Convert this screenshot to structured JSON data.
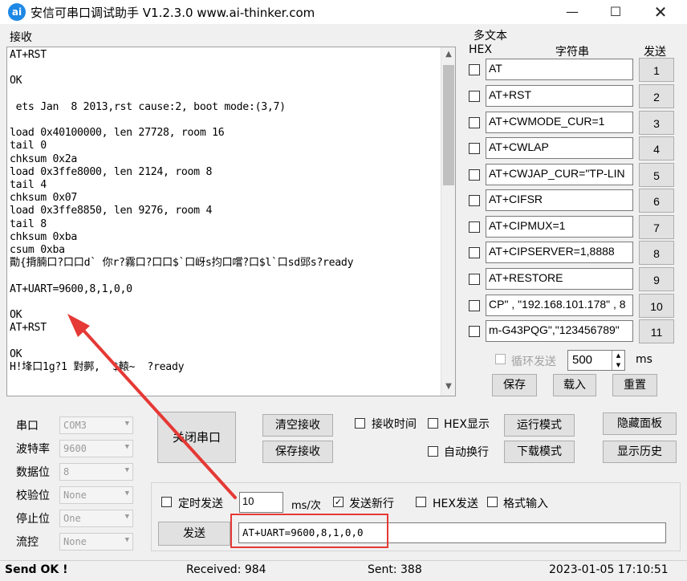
{
  "window": {
    "title": "安信可串口调试助手 V1.2.3.0    www.ai-thinker.com",
    "icon_text": "ai",
    "min_glyph": "—",
    "max_glyph": "☐",
    "close_glyph": "✕"
  },
  "receive": {
    "label": "接收",
    "text": "AT+RST\n\nOK\n\n ets Jan  8 2013,rst cause:2, boot mode:(3,7)\n\nload 0x40100000, len 27728, room 16\ntail 0\nchksum 0x2a\nload 0x3ffe8000, len 2124, room 8\ntail 4\nchksum 0x07\nload 0x3ffe8850, len 9276, room 4\ntail 8\nchksum 0xba\ncsum 0xba\n勩{揹腩口?口口d` 你r?霧口?口口$`口岈s抣口嚐?口$l`口sd郖s?ready\n\nAT+UART=9600,8,1,0,0\n\nOK\nAT+RST\n\nOK\nH!埄口1g?1 對鄸,  $轅~  ?ready"
  },
  "multi_text": {
    "label": "多文本",
    "hex_header": "HEX",
    "string_header": "字符串",
    "send_header": "发送",
    "rows": [
      {
        "value": "AT",
        "btn": "1"
      },
      {
        "value": "AT+RST",
        "btn": "2"
      },
      {
        "value": "AT+CWMODE_CUR=1",
        "btn": "3"
      },
      {
        "value": "AT+CWLAP",
        "btn": "4"
      },
      {
        "value": "AT+CWJAP_CUR=\"TP-LIN",
        "btn": "5"
      },
      {
        "value": "AT+CIFSR",
        "btn": "6"
      },
      {
        "value": "AT+CIPMUX=1",
        "btn": "7"
      },
      {
        "value": "AT+CIPSERVER=1,8888",
        "btn": "8"
      },
      {
        "value": "AT+RESTORE",
        "btn": "9"
      },
      {
        "value": "CP\" , \"192.168.101.178\" , 8",
        "btn": "10"
      },
      {
        "value": "m-G43PQG\",\"123456789\"",
        "btn": "11"
      }
    ],
    "loop_label": "循环发送",
    "loop_ms": "500",
    "ms_label": "ms",
    "save": "保存",
    "load": "载入",
    "reset": "重置"
  },
  "serial": {
    "port_label": "串口",
    "port_value": "COM3",
    "baud_label": "波特率",
    "baud_value": "9600",
    "data_label": "数据位",
    "data_value": "8",
    "parity_label": "校验位",
    "parity_value": "None",
    "stop_label": "停止位",
    "stop_value": "One",
    "flow_label": "流控",
    "flow_value": "None",
    "open_btn": "关闭串口"
  },
  "recv_controls": {
    "clear": "清空接收",
    "save": "保存接收",
    "recv_time": "接收时间",
    "hex_show": "HEX显示",
    "run_mode": "运行模式",
    "hide_panel": "隐藏面板",
    "auto_wrap": "自动换行",
    "download_mode": "下载模式",
    "show_history": "显示历史"
  },
  "send_controls": {
    "timed_send": "定时发送",
    "interval": "10",
    "interval_unit": "ms/次",
    "new_line": "发送新行",
    "hex_send": "HEX发送",
    "format_input": "格式输入",
    "send_btn": "发送",
    "send_text": "AT+UART=9600,8,1,0,0"
  },
  "status": {
    "ok": "Send OK !",
    "received": "Received: 984",
    "sent": "Sent: 388",
    "time": "2023-01-05 17:10:51"
  },
  "colors": {
    "accent": "#e53935",
    "window_bg": "#f0f0f0"
  }
}
